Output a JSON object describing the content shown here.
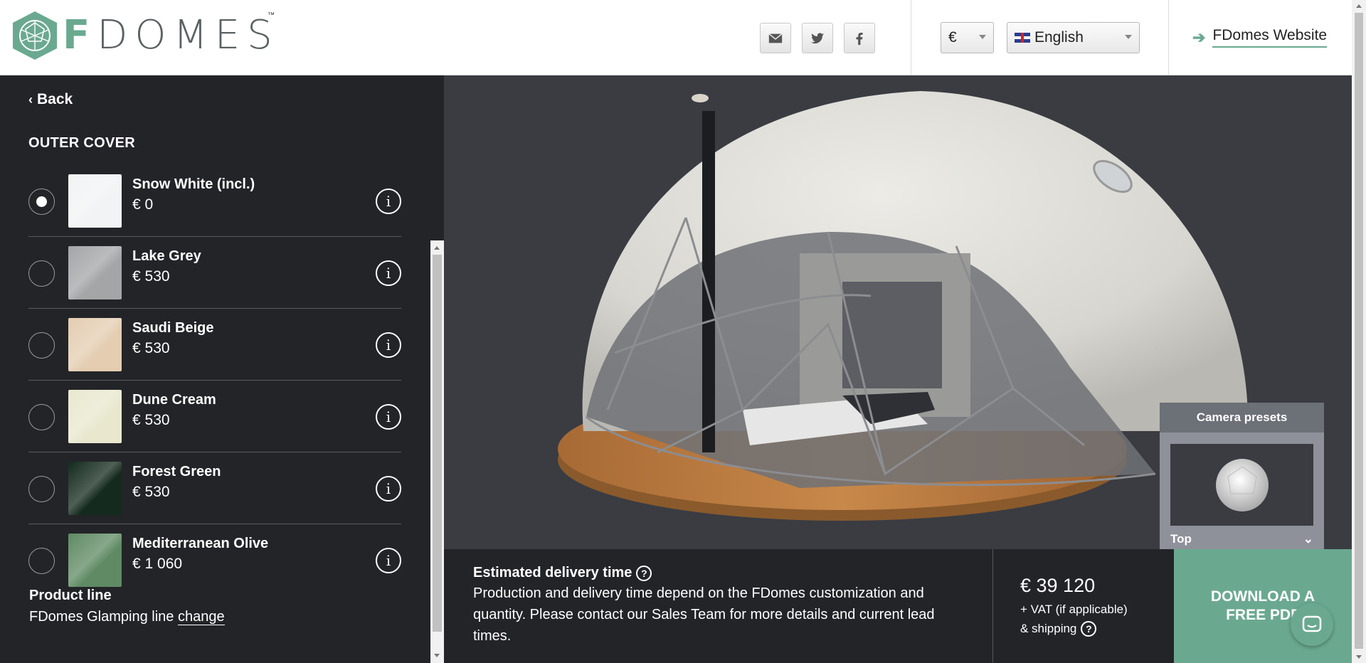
{
  "header": {
    "logo_letter": "F",
    "logo_rest": "DOMES",
    "logo_tm": "™",
    "social_icons": [
      "email-icon",
      "twitter-icon",
      "facebook-icon"
    ],
    "currency": "€",
    "language": "English",
    "website_link": "FDomes Website"
  },
  "sidebar": {
    "back": "Back",
    "section_title": "OUTER COVER",
    "options": [
      {
        "name": "Snow White (incl.)",
        "price": "€ 0",
        "color": "#f2f3f4",
        "selected": true
      },
      {
        "name": "Lake Grey",
        "price": "€ 530",
        "color": "#a3a5a7",
        "selected": false
      },
      {
        "name": "Saudi Beige",
        "price": "€ 530",
        "color": "#e4cdb1",
        "selected": false
      },
      {
        "name": "Dune Cream",
        "price": "€ 530",
        "color": "#e9e8cf",
        "selected": false
      },
      {
        "name": "Forest Green",
        "price": "€ 530",
        "color": "#142a1e",
        "selected": false
      },
      {
        "name": "Mediterranean Olive",
        "price": "€ 1 060",
        "color": "#5f8a63",
        "selected": false
      }
    ],
    "info_glyph": "i",
    "product_line_title": "Product line",
    "product_line_value": "FDomes Glamping line",
    "product_line_link": "change"
  },
  "camera": {
    "title": "Camera presets",
    "preset": "Top"
  },
  "footer": {
    "delivery_title": "Estimated delivery time",
    "delivery_text": "Production and delivery time depend on the FDomes customization and quantity. Please contact our Sales Team for more details and current lead times.",
    "price": "€ 39 120",
    "vat": "+ VAT (if applicable)",
    "shipping": "& shipping",
    "download": "DOWNLOAD A FREE PDF"
  },
  "colors": {
    "brand": "#6aa990",
    "panel": "#232428",
    "viewport": "#3a3c42"
  }
}
